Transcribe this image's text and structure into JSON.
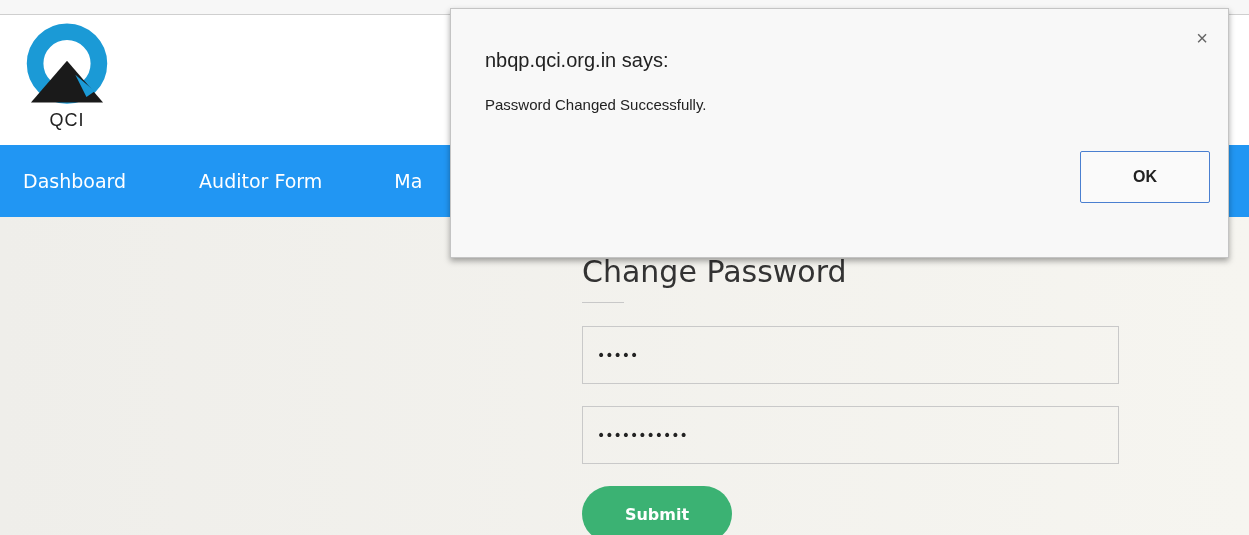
{
  "header": {
    "logo_text": "QCI"
  },
  "nav": {
    "items": [
      {
        "label": "Dashboard"
      },
      {
        "label": "Auditor Form"
      },
      {
        "label": "Ma"
      }
    ]
  },
  "form": {
    "title": "Change Password",
    "fields": [
      {
        "value": "•••••"
      },
      {
        "value": "•••••••••••"
      }
    ],
    "submit": "Submit"
  },
  "dialog": {
    "title": "nbqp.qci.org.in says:",
    "message": "Password Changed Successfully.",
    "close": "×",
    "button": "OK"
  }
}
